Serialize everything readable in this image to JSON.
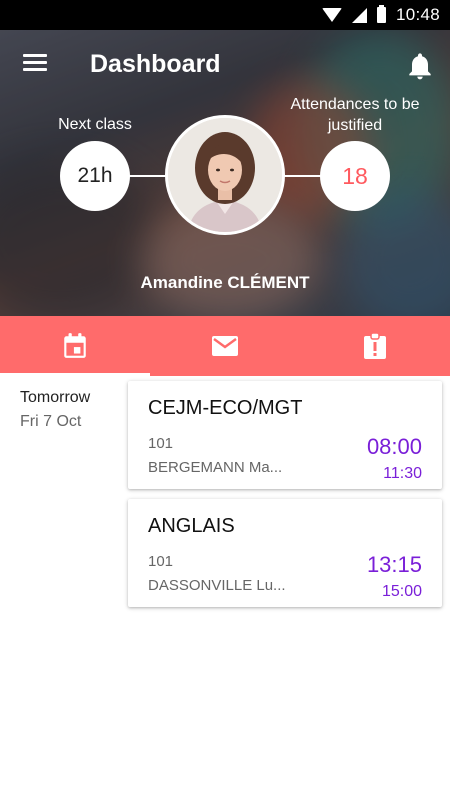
{
  "status_bar": {
    "time": "10:48"
  },
  "header": {
    "title": "Dashboard",
    "next_class_label": "Next class",
    "next_class_value": "21h",
    "attendances_label": "Attendances to be justified",
    "attendances_value": "18",
    "user_name": "Amandine CLÉMENT"
  },
  "tabs": [
    {
      "icon": "calendar-icon",
      "active": true
    },
    {
      "icon": "mail-icon",
      "active": false
    },
    {
      "icon": "clipboard-alert-icon",
      "active": false
    }
  ],
  "agenda": {
    "day_label": "Tomorrow",
    "day_date": "Fri 7 Oct",
    "classes": [
      {
        "subject": "CEJM-ECO/MGT",
        "room": "101",
        "teacher": "BERGEMANN Ma...",
        "start": "08:00",
        "end": "11:30"
      },
      {
        "subject": "ANGLAIS",
        "room": "101",
        "teacher": "DASSONVILLE Lu...",
        "start": "13:15",
        "end": "15:00"
      }
    ]
  },
  "colors": {
    "accent": "#ff6b6b",
    "time_purple": "#7a1fd8",
    "attendance_red": "#ff5a5f"
  }
}
